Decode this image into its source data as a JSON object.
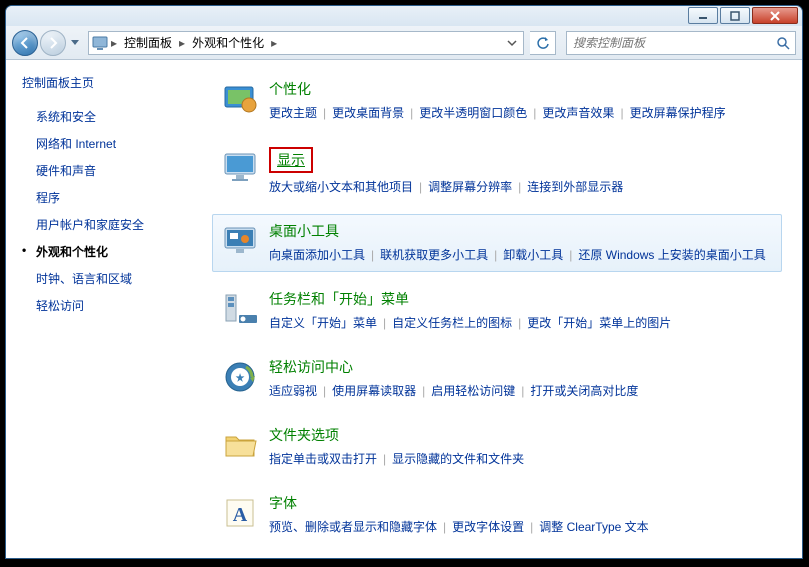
{
  "titlebar": {
    "minimize": "_",
    "maximize": "□",
    "close": "✕"
  },
  "nav": {
    "breadcrumb": [
      "控制面板",
      "外观和个性化"
    ],
    "search_placeholder": "搜索控制面板"
  },
  "sidebar": {
    "home": "控制面板主页",
    "items": [
      {
        "label": "系统和安全"
      },
      {
        "label": "网络和 Internet"
      },
      {
        "label": "硬件和声音"
      },
      {
        "label": "程序"
      },
      {
        "label": "用户帐户和家庭安全"
      },
      {
        "label": "外观和个性化",
        "active": true
      },
      {
        "label": "时钟、语言和区域"
      },
      {
        "label": "轻松访问"
      }
    ]
  },
  "categories": [
    {
      "title": "个性化",
      "icon": "personalize",
      "links": [
        "更改主题",
        "更改桌面背景",
        "更改半透明窗口颜色",
        "更改声音效果",
        "更改屏幕保护程序"
      ]
    },
    {
      "title": "显示",
      "icon": "display",
      "boxed": true,
      "links": [
        "放大或缩小文本和其他项目",
        "调整屏幕分辨率",
        "连接到外部显示器"
      ]
    },
    {
      "title": "桌面小工具",
      "icon": "gadgets",
      "highlighted": true,
      "links": [
        "向桌面添加小工具",
        "联机获取更多小工具",
        "卸载小工具",
        "还原 Windows 上安装的桌面小工具"
      ]
    },
    {
      "title": "任务栏和「开始」菜单",
      "icon": "taskbar",
      "links": [
        "自定义「开始」菜单",
        "自定义任务栏上的图标",
        "更改「开始」菜单上的图片"
      ]
    },
    {
      "title": "轻松访问中心",
      "icon": "ease",
      "links": [
        "适应弱视",
        "使用屏幕读取器",
        "启用轻松访问键",
        "打开或关闭高对比度"
      ]
    },
    {
      "title": "文件夹选项",
      "icon": "folder",
      "links": [
        "指定单击或双击打开",
        "显示隐藏的文件和文件夹"
      ]
    },
    {
      "title": "字体",
      "icon": "fonts",
      "links": [
        "预览、删除或者显示和隐藏字体",
        "更改字体设置",
        "调整 ClearType 文本"
      ]
    }
  ]
}
